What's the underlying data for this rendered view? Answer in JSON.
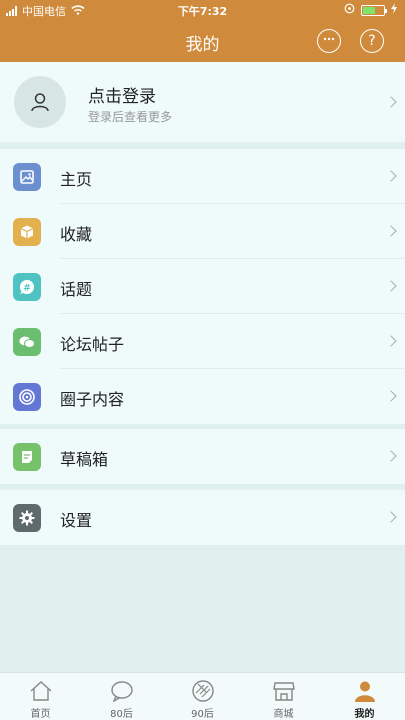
{
  "status_bar": {
    "carrier": "中国电信",
    "time": "下午7:32"
  },
  "nav": {
    "title": "我的",
    "chat_icon": "chat-bubble-icon",
    "help_label": "?"
  },
  "login": {
    "title": "点击登录",
    "subtitle": "登录后查看更多"
  },
  "menu": {
    "home": "主页",
    "favorites": "收藏",
    "topics": "话题",
    "forum_posts": "论坛帖子",
    "circle_content": "圈子内容",
    "drafts": "草稿箱",
    "settings": "设置"
  },
  "tabs": {
    "home": "首页",
    "80s": "80后",
    "90s": "90后",
    "mall": "商城",
    "mine": "我的"
  },
  "colors": {
    "accent": "#d08a3b",
    "home_icon": "#6c8fd0",
    "favorites_icon": "#e2b04d",
    "topics_icon": "#4fc3c1",
    "forum_icon": "#6bbd70",
    "circle_icon": "#6378d4",
    "drafts_icon": "#76c26a",
    "settings_icon": "#5f6a6d"
  }
}
